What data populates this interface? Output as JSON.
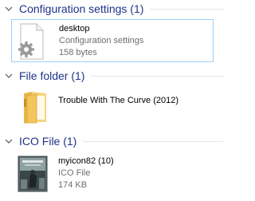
{
  "groups": [
    {
      "title": "Configuration settings (1)",
      "items": [
        {
          "name": "desktop",
          "type": "Configuration settings",
          "size": "158 bytes",
          "icon": "settings-file-icon"
        }
      ]
    },
    {
      "title": "File folder (1)",
      "items": [
        {
          "name": "Trouble With The Curve (2012)",
          "icon": "folder-icon"
        }
      ]
    },
    {
      "title": "ICO File (1)",
      "items": [
        {
          "name": "myicon82 (10)",
          "type": "ICO File",
          "size": "174 KB",
          "icon": "ico-thumbnail-icon"
        }
      ]
    }
  ],
  "colors": {
    "header_text": "#1e3287",
    "selection_border": "#99d1ff",
    "secondary_text": "#6d6d6d"
  }
}
